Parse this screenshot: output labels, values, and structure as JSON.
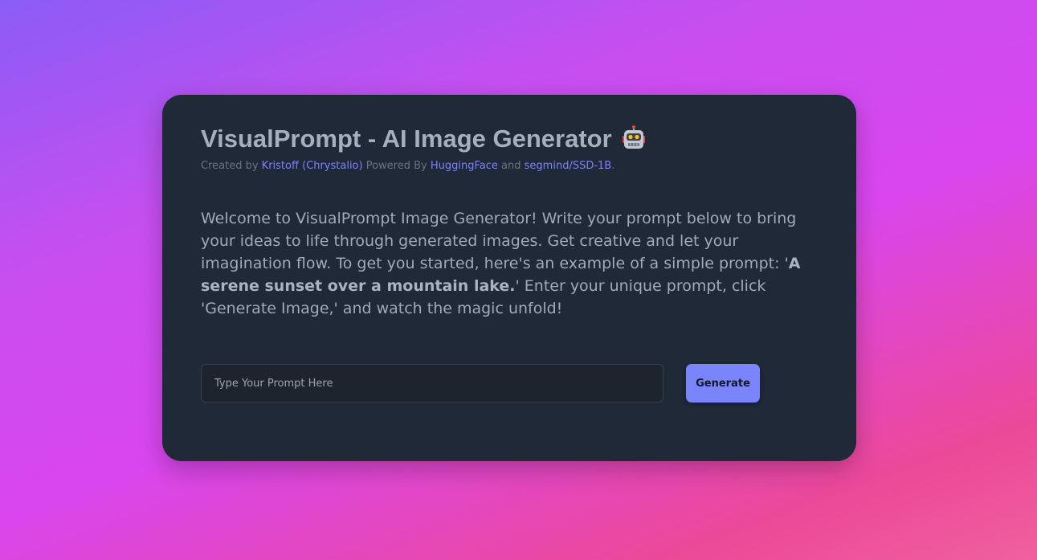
{
  "header": {
    "title": "VisualPrompt - AI Image Generator",
    "title_icon": "robot-icon"
  },
  "byline": {
    "created_by_prefix": "Created by",
    "author_link": "Kristoff (Chrystalio)",
    "powered_by_prefix": "Powered By",
    "huggingface_link": "HuggingFace",
    "and_text": "and",
    "model_link": "segmind/SSD-1B",
    "suffix": "."
  },
  "welcome": {
    "intro": "Welcome to VisualPrompt Image Generator! Write your prompt below to bring your ideas to life through generated images. Get creative and let your imagination flow. To get you started, here's an example of a simple prompt: '",
    "example": "A serene sunset over a mountain lake.",
    "outro": "' Enter your unique prompt, click 'Generate Image,' and watch the magic unfold!"
  },
  "prompt": {
    "value": "",
    "placeholder": "Type Your Prompt Here"
  },
  "actions": {
    "generate_label": "Generate"
  },
  "colors": {
    "card_background": "#1f2937",
    "link": "#7c83f7",
    "button": "#7b85fb",
    "gradient_start": "#8b5cf6",
    "gradient_end": "#f0609e"
  }
}
